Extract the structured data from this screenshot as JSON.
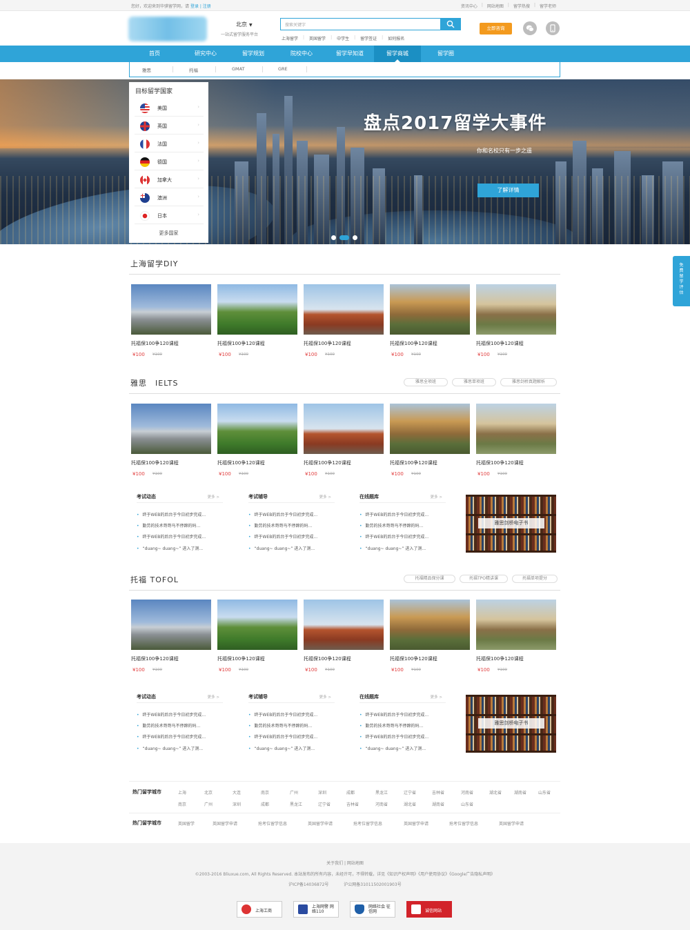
{
  "topbar": {
    "greeting": "您好，欢迎来到华骐留学网，请",
    "login": "登录",
    "register": "注册",
    "links": [
      "资讯中心",
      "网站地图",
      "留学热搜",
      "留学老师"
    ]
  },
  "header": {
    "city": "北京",
    "slogan": "一站式留学服务平台",
    "search_placeholder": "搜索关键字",
    "quick_links": [
      "上海留学",
      "英国留学",
      "中学生",
      "留学签证",
      "如何报名"
    ],
    "consult_button": "立即咨询"
  },
  "nav": {
    "items": [
      "首页",
      "研究中心",
      "留学规划",
      "院校中心",
      "留学早知道",
      "留学商城",
      "留学圈"
    ],
    "active_index": 5
  },
  "subnav": [
    "雅思",
    "托福",
    "GMAT",
    "GRE"
  ],
  "banner": {
    "title": "盘点2017留学大事件",
    "subtitle": "你和名校只有一步之遥",
    "button": "了解详情"
  },
  "countries": {
    "header": "目标留学国家",
    "items": [
      "美国",
      "英国",
      "法国",
      "德国",
      "加拿大",
      "澳洲",
      "日本"
    ],
    "more": "更多国家"
  },
  "side_float": "免费留学评估",
  "sections": [
    {
      "title": "上海留学DIY",
      "tags": [],
      "cards": [
        {
          "title": "托福保100争120课程",
          "price": "¥100",
          "old": "¥100"
        },
        {
          "title": "托福保100争120课程",
          "price": "¥100",
          "old": "¥100"
        },
        {
          "title": "托福保100争120课程",
          "price": "¥100",
          "old": "¥100"
        },
        {
          "title": "托福保100争120课程",
          "price": "¥100",
          "old": "¥100"
        },
        {
          "title": "托福保100争120课程",
          "price": "¥100",
          "old": "¥100"
        }
      ]
    },
    {
      "title": "雅思　IELTS",
      "tags": [
        "雅思全项班",
        "雅思单项班",
        "雅思剑桥真题解析"
      ],
      "cards": [
        {
          "title": "托福保100争120课程",
          "price": "¥100",
          "old": "¥100"
        },
        {
          "title": "托福保100争120课程",
          "price": "¥100",
          "old": "¥100"
        },
        {
          "title": "托福保100争120课程",
          "price": "¥100",
          "old": "¥100"
        },
        {
          "title": "托福保100争120课程",
          "price": "¥100",
          "old": "¥100"
        },
        {
          "title": "托福保100争120课程",
          "price": "¥100",
          "old": "¥100"
        }
      ]
    },
    {
      "title": "托福 TOFOL",
      "tags": [
        "托福精品保分课",
        "托福TPO精讲课",
        "托福单项提分"
      ],
      "cards": [
        {
          "title": "托福保100争120课程",
          "price": "¥100",
          "old": "¥100"
        },
        {
          "title": "托福保100争120课程",
          "price": "¥100",
          "old": "¥100"
        },
        {
          "title": "托福保100争120课程",
          "price": "¥100",
          "old": "¥100"
        },
        {
          "title": "托福保100争120课程",
          "price": "¥100",
          "old": "¥100"
        },
        {
          "title": "托福保100争120课程",
          "price": "¥100",
          "old": "¥100"
        }
      ]
    }
  ],
  "news": {
    "more": "更多 >",
    "headers": [
      "考试动态",
      "考试辅导",
      "在线题库"
    ],
    "items": [
      "终于WEB的后台于今日初步完成...",
      "勤劳的技术哥哥马不停蹄的码...",
      "终于WEB的后台于今日初步完成...",
      "“duang~ duang~” 进入了测..."
    ],
    "book_label": "雅思剑桥电子书"
  },
  "hot": {
    "label1": "热门留学城市",
    "row1": [
      "上海",
      "北京",
      "大连",
      "南京",
      "广州",
      "深圳",
      "成都",
      "黑龙江",
      "辽宁省",
      "吉林省",
      "河南省",
      "湖北省",
      "湖南省",
      "山东省"
    ],
    "row2": [
      "南京",
      "广州",
      "深圳",
      "成都",
      "黑龙江",
      "辽宁省",
      "吉林省",
      "河南省",
      "湖北省",
      "湖南省",
      "山东省"
    ],
    "label2": "热门留学城市",
    "row3": [
      "英国留学",
      "英国留学申请",
      "抢考位留学信息",
      "英国留学申请",
      "抢考位留学信息",
      "英国留学申请",
      "抢考位留学信息",
      "英国留学申请"
    ]
  },
  "footer": {
    "links": "关于我们 | 网站地图",
    "copyright": "©2003-2016 Bliuxue.com, All Rights Reserved.  本站发布的所有内容，未经许可，不得转载，详见《知识产权声明》《用户使用协议》《Google广告隐私声明》",
    "icp": "沪ICP备14036872号",
    "police": "沪公网备31011502001903号",
    "badges": [
      "上海工商",
      "上海网警 网络110",
      "网络社会 征信网",
      "诚信网站"
    ]
  }
}
